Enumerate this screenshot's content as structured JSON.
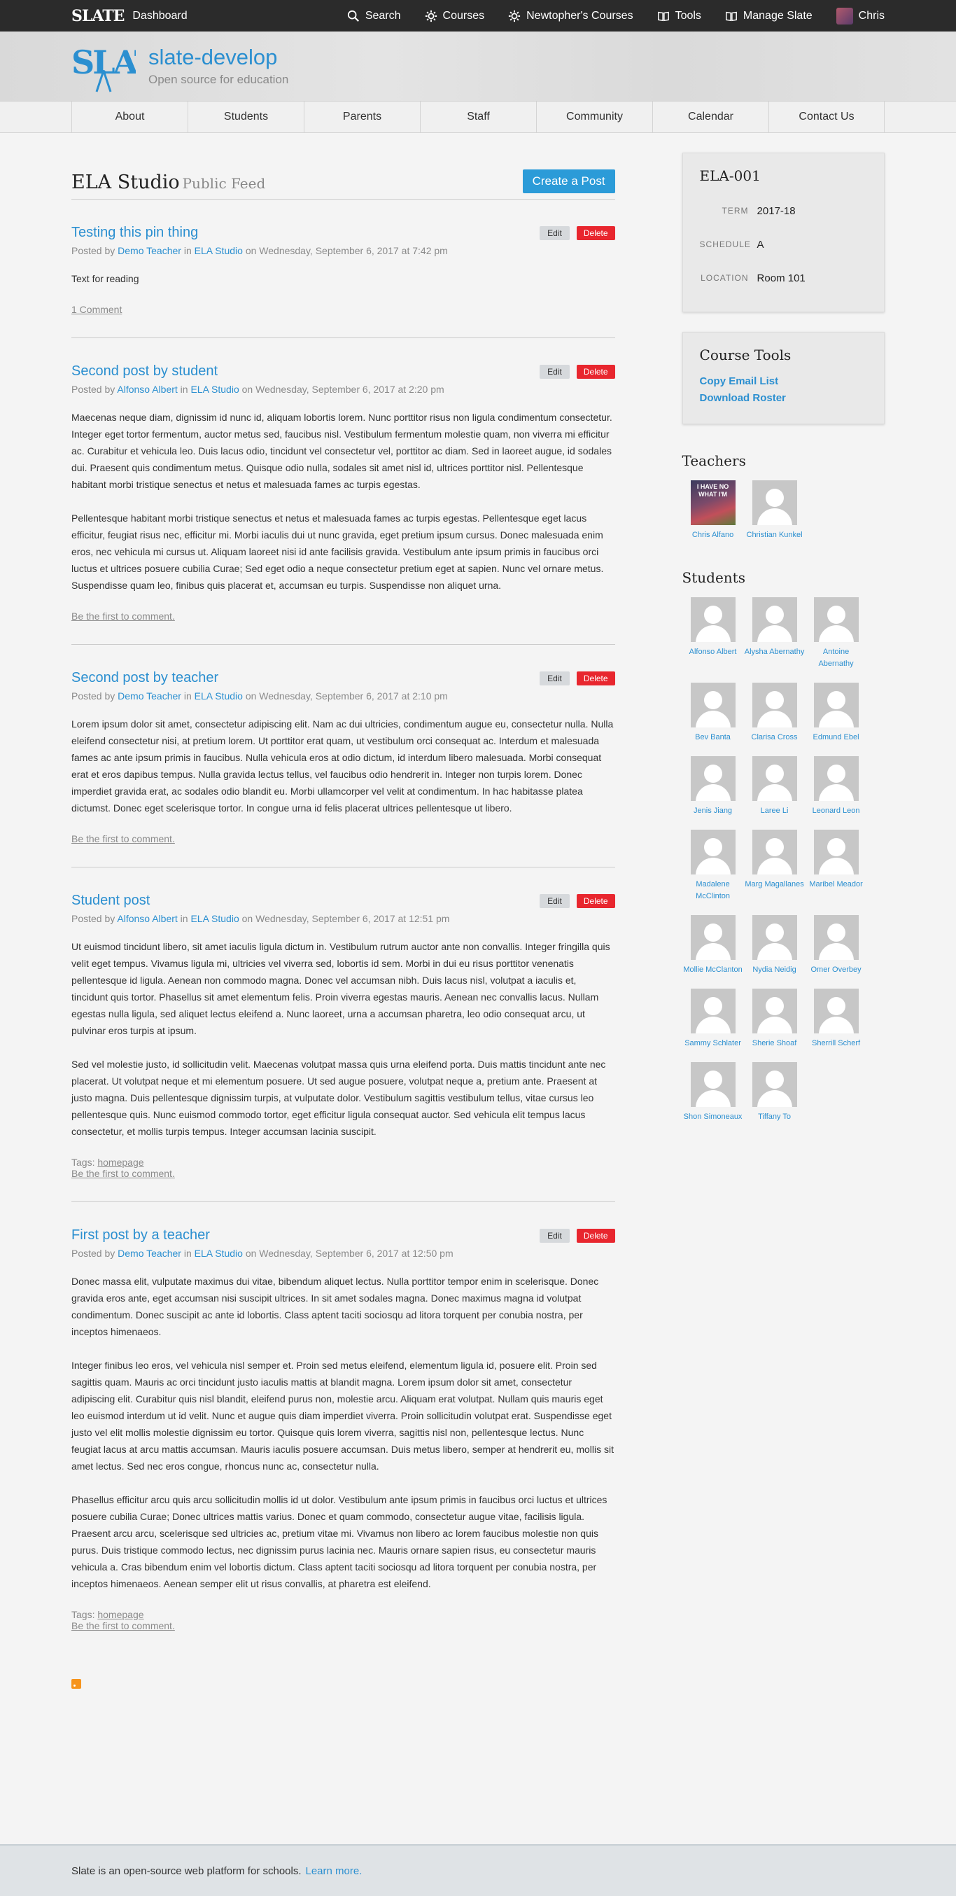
{
  "topbar": {
    "brand_logo": "SLATE",
    "dashboard": "Dashboard",
    "search": "Search",
    "courses": "Courses",
    "newtophers_courses": "Newtopher's Courses",
    "tools": "Tools",
    "manage_slate": "Manage Slate",
    "user": "Chris"
  },
  "header": {
    "site_name": "slate-develop",
    "tagline": "Open source for education"
  },
  "subnav": [
    "About",
    "Students",
    "Parents",
    "Staff",
    "Community",
    "Calendar",
    "Contact Us"
  ],
  "feed": {
    "title": "ELA Studio",
    "subtitle": "Public Feed",
    "create_button": "Create a Post"
  },
  "labels": {
    "edit": "Edit",
    "delete": "Delete",
    "posted_by": "Posted by",
    "in": "in",
    "on": "on",
    "tags": "Tags:"
  },
  "posts": [
    {
      "title": "Testing this pin thing",
      "author": "Demo Teacher",
      "section": "ELA Studio",
      "date": "Wednesday, September 6, 2017 at 7:42 pm",
      "paragraphs": [
        "Text for reading"
      ],
      "tags": "",
      "comment": "1 Comment"
    },
    {
      "title": "Second post by student",
      "author": "Alfonso Albert",
      "section": "ELA Studio",
      "date": "Wednesday, September 6, 2017 at 2:20 pm",
      "paragraphs": [
        "Maecenas neque diam, dignissim id nunc id, aliquam lobortis lorem. Nunc porttitor risus non ligula condimentum consectetur. Integer eget tortor fermentum, auctor metus sed, faucibus nisl. Vestibulum fermentum molestie quam, non viverra mi efficitur ac. Curabitur et vehicula leo. Duis lacus odio, tincidunt vel consectetur vel, porttitor ac diam. Sed in laoreet augue, id sodales dui. Praesent quis condimentum metus. Quisque odio nulla, sodales sit amet nisl id, ultrices porttitor nisl. Pellentesque habitant morbi tristique senectus et netus et malesuada fames ac turpis egestas.",
        "Pellentesque habitant morbi tristique senectus et netus et malesuada fames ac turpis egestas. Pellentesque eget lacus efficitur, feugiat risus nec, efficitur mi. Morbi iaculis dui ut nunc gravida, eget pretium ipsum cursus. Donec malesuada enim eros, nec vehicula mi cursus ut. Aliquam laoreet nisi id ante facilisis gravida. Vestibulum ante ipsum primis in faucibus orci luctus et ultrices posuere cubilia Curae; Sed eget odio a neque consectetur pretium eget at sapien. Nunc vel ornare metus. Suspendisse quam leo, finibus quis placerat et, accumsan eu turpis. Suspendisse non aliquet urna."
      ],
      "tags": "",
      "comment": "Be the first to comment."
    },
    {
      "title": "Second post by teacher",
      "author": "Demo Teacher",
      "section": "ELA Studio",
      "date": "Wednesday, September 6, 2017 at 2:10 pm",
      "paragraphs": [
        "Lorem ipsum dolor sit amet, consectetur adipiscing elit. Nam ac dui ultricies, condimentum augue eu, consectetur nulla. Nulla eleifend consectetur nisi, at pretium lorem. Ut porttitor erat quam, ut vestibulum orci consequat ac. Interdum et malesuada fames ac ante ipsum primis in faucibus. Nulla vehicula eros at odio dictum, id interdum libero malesuada. Morbi consequat erat et eros dapibus tempus. Nulla gravida lectus tellus, vel faucibus odio hendrerit in. Integer non turpis lorem. Donec imperdiet gravida erat, ac sodales odio blandit eu. Morbi ullamcorper vel velit at condimentum. In hac habitasse platea dictumst. Donec eget scelerisque tortor. In congue urna id felis placerat ultrices pellentesque ut libero."
      ],
      "tags": "",
      "comment": "Be the first to comment."
    },
    {
      "title": "Student post",
      "author": "Alfonso Albert",
      "section": "ELA Studio",
      "date": "Wednesday, September 6, 2017 at 12:51 pm",
      "paragraphs": [
        "Ut euismod tincidunt libero, sit amet iaculis ligula dictum in. Vestibulum rutrum auctor ante non convallis. Integer fringilla quis velit eget tempus. Vivamus ligula mi, ultricies vel viverra sed, lobortis id sem. Morbi in dui eu risus porttitor venenatis pellentesque id ligula. Aenean non commodo magna. Donec vel accumsan nibh. Duis lacus nisl, volutpat a iaculis et, tincidunt quis tortor. Phasellus sit amet elementum felis. Proin viverra egestas mauris. Aenean nec convallis lacus. Nullam egestas nulla ligula, sed aliquet lectus eleifend a. Nunc laoreet, urna a accumsan pharetra, leo odio consequat arcu, ut pulvinar eros turpis at ipsum.",
        "Sed vel molestie justo, id sollicitudin velit. Maecenas volutpat massa quis urna eleifend porta. Duis mattis tincidunt ante nec placerat. Ut volutpat neque et mi elementum posuere. Ut sed augue posuere, volutpat neque a, pretium ante. Praesent at justo magna. Duis pellentesque dignissim turpis, at vulputate dolor. Vestibulum sagittis vestibulum tellus, vitae cursus leo pellentesque quis. Nunc euismod commodo tortor, eget efficitur ligula consequat auctor. Sed vehicula elit tempus lacus consectetur, et mollis turpis tempus. Integer accumsan lacinia suscipit."
      ],
      "tags": "homepage",
      "comment": "Be the first to comment."
    },
    {
      "title": "First post by a teacher",
      "author": "Demo Teacher",
      "section": "ELA Studio",
      "date": "Wednesday, September 6, 2017 at 12:50 pm",
      "paragraphs": [
        "Donec massa elit, vulputate maximus dui vitae, bibendum aliquet lectus. Nulla porttitor tempor enim in scelerisque. Donec gravida eros ante, eget accumsan nisi suscipit ultrices. In sit amet sodales magna. Donec maximus magna id volutpat condimentum. Donec suscipit ac ante id lobortis. Class aptent taciti sociosqu ad litora torquent per conubia nostra, per inceptos himenaeos.",
        "Integer finibus leo eros, vel vehicula nisl semper et. Proin sed metus eleifend, elementum ligula id, posuere elit. Proin sed sagittis quam. Mauris ac orci tincidunt justo iaculis mattis at blandit magna. Lorem ipsum dolor sit amet, consectetur adipiscing elit. Curabitur quis nisl blandit, eleifend purus non, molestie arcu. Aliquam erat volutpat. Nullam quis mauris eget leo euismod interdum ut id velit. Nunc et augue quis diam imperdiet viverra. Proin sollicitudin volutpat erat. Suspendisse eget justo vel elit mollis molestie dignissim eu tortor. Quisque quis lorem viverra, sagittis nisl non, pellentesque lectus. Nunc feugiat lacus at arcu mattis accumsan. Mauris iaculis posuere accumsan. Duis metus libero, semper at hendrerit eu, mollis sit amet lectus. Sed nec eros congue, rhoncus nunc ac, consectetur nulla.",
        "Phasellus efficitur arcu quis arcu sollicitudin mollis id ut dolor. Vestibulum ante ipsum primis in faucibus orci luctus et ultrices posuere cubilia Curae; Donec ultrices mattis varius. Donec et quam commodo, consectetur augue vitae, facilisis ligula. Praesent arcu arcu, scelerisque sed ultricies ac, pretium vitae mi. Vivamus non libero ac lorem faucibus molestie non quis purus. Duis tristique commodo lectus, nec dignissim purus lacinia nec. Mauris ornare sapien risus, eu consectetur mauris vehicula a. Cras bibendum enim vel lobortis dictum. Class aptent taciti sociosqu ad litora torquent per conubia nostra, per inceptos himenaeos. Aenean semper elit ut risus convallis, at pharetra est eleifend."
      ],
      "tags": "homepage",
      "comment": "Be the first to comment."
    }
  ],
  "sidebar": {
    "course": {
      "code": "ELA-001",
      "term_label": "TERM",
      "term": "2017-18",
      "schedule_label": "SCHEDULE",
      "schedule": "A",
      "location_label": "LOCATION",
      "location": "Room 101"
    },
    "tools": {
      "title": "Course Tools",
      "copy_email": "Copy Email List",
      "download_roster": "Download Roster"
    },
    "teachers_title": "Teachers",
    "teachers": [
      {
        "name": "Chris Alfano",
        "photo": true,
        "photo_text": "I HAVE NO WHAT I'M"
      },
      {
        "name": "Christian Kunkel",
        "photo": false,
        "photo_text": ""
      }
    ],
    "students_title": "Students",
    "students": [
      "Alfonso Albert",
      "Alysha Abernathy",
      "Antoine Abernathy",
      "Bev Banta",
      "Clarisa Cross",
      "Edmund Ebel",
      "Jenis Jiang",
      "Laree Li",
      "Leonard Leon",
      "Madalene McClinton",
      "Marg Magallanes",
      "Maribel Meador",
      "Mollie McClanton",
      "Nydia Neidig",
      "Omer Overbey",
      "Sammy Schlater",
      "Sherie Shoaf",
      "Sherrill Scherf",
      "Shon Simoneaux",
      "Tiffany To"
    ]
  },
  "footer": {
    "text": "Slate is an open-source web platform for schools.",
    "link": "Learn more."
  },
  "colors": {
    "accent": "#2b8fd0",
    "delete": "#e8262e",
    "topbar": "#2b2b2b"
  }
}
